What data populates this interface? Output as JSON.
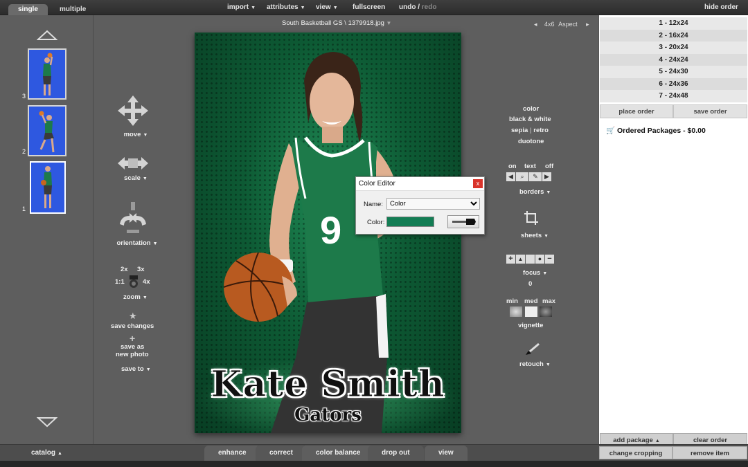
{
  "topbar": {
    "tabs": [
      "single",
      "multiple"
    ],
    "menu": {
      "import": "import",
      "attributes": "attributes",
      "view": "view",
      "fullscreen": "fullscreen",
      "undo": "undo",
      "separator": "/",
      "redo": "redo",
      "hide_order": "hide order"
    }
  },
  "left": {
    "thumbnails": [
      {
        "number": "3"
      },
      {
        "number": "2"
      },
      {
        "number": "1"
      }
    ],
    "tools": {
      "move": "move",
      "scale": "scale",
      "orientation": "orientation",
      "zoom": "zoom",
      "zoom_2x": "2x",
      "zoom_3x": "3x",
      "zoom_1x": "1:1",
      "zoom_4x": "4x",
      "save_changes": "save changes",
      "save_as_new_1": "save as",
      "save_as_new_2": "new photo",
      "save_to": "save to"
    },
    "catalog": "catalog"
  },
  "photo": {
    "filename": "South Basketball GS \\ 1379918.jpg",
    "aspect": "4x6",
    "aspect_label": "Aspect",
    "name": "Kate Smith",
    "team": "Gators",
    "jersey_number": "9"
  },
  "right_tools": {
    "color": "color",
    "bw": "black & white",
    "sepia": "sepia",
    "pipe": "|",
    "retro": "retro",
    "duotone": "duotone",
    "on": "on",
    "text": "text",
    "off": "off",
    "borders": "borders",
    "sheets": "sheets",
    "focus": "focus",
    "focus_value": "0",
    "min": "min",
    "med": "med",
    "max": "max",
    "vignette": "vignette",
    "retouch": "retouch"
  },
  "dialog": {
    "title": "Color Editor",
    "close": "x",
    "name_label": "Name:",
    "name_value": "Color",
    "color_label": "Color:",
    "color_value": "#137d54"
  },
  "order": {
    "sizes": [
      "1 - 12x24",
      "2 - 16x24",
      "3 - 20x24",
      "4 - 24x24",
      "5 - 24x30",
      "6 - 24x36",
      "7 - 24x48"
    ],
    "place_order": "place order",
    "save_order": "save order",
    "ordered_packages": "Ordered Packages - $0.00",
    "add_package": "add package",
    "clear_order": "clear order",
    "change_cropping": "change cropping",
    "remove_item": "remove item"
  },
  "bottom": {
    "tabs": [
      "enhance",
      "correct",
      "color balance",
      "drop out",
      "view"
    ]
  },
  "colors": {
    "thumb_bg": "#2e58e0",
    "jersey": "#1d7a4a",
    "accent": "#137d54"
  }
}
